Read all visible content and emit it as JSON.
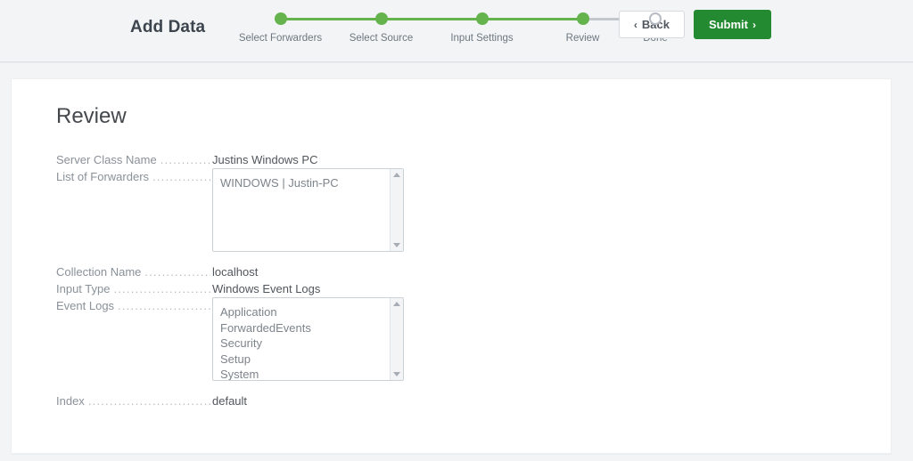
{
  "header": {
    "title": "Add Data",
    "stepper": [
      {
        "label": "Select Forwarders",
        "state": "complete"
      },
      {
        "label": "Select Source",
        "state": "complete"
      },
      {
        "label": "Input Settings",
        "state": "complete"
      },
      {
        "label": "Review",
        "state": "complete"
      },
      {
        "label": "Done",
        "state": "pending"
      }
    ],
    "back_label": "Back",
    "back_chevron": "‹",
    "submit_label": "Submit",
    "submit_chevron": "›"
  },
  "colors": {
    "step_complete": "#65b34d",
    "step_pending": "#b8bcc4",
    "submit_bg": "#248a32",
    "page_bg": "#f2f4f5",
    "card_bg": "#ffffff"
  },
  "main": {
    "page_title": "Review",
    "rows": [
      {
        "label": "Server Class Name",
        "leader": "..............................................................",
        "type": "text",
        "value": "Justins Windows PC"
      },
      {
        "label": "List of Forwarders",
        "leader": "..............................................................",
        "type": "list",
        "items": [
          "WINDOWS | Justin-PC"
        ]
      },
      {
        "label": "Collection Name",
        "leader": "..............................................................",
        "type": "text",
        "value": "localhost"
      },
      {
        "label": "Input Type",
        "leader": "..............................................................",
        "type": "text",
        "value": "Windows Event Logs"
      },
      {
        "label": "Event Logs",
        "leader": "..............................................................",
        "type": "list",
        "items": [
          "Application",
          "ForwardedEvents",
          "Security",
          "Setup",
          "System"
        ]
      },
      {
        "label": "Index",
        "leader": "..............................................................",
        "type": "text",
        "value": "default"
      }
    ]
  }
}
